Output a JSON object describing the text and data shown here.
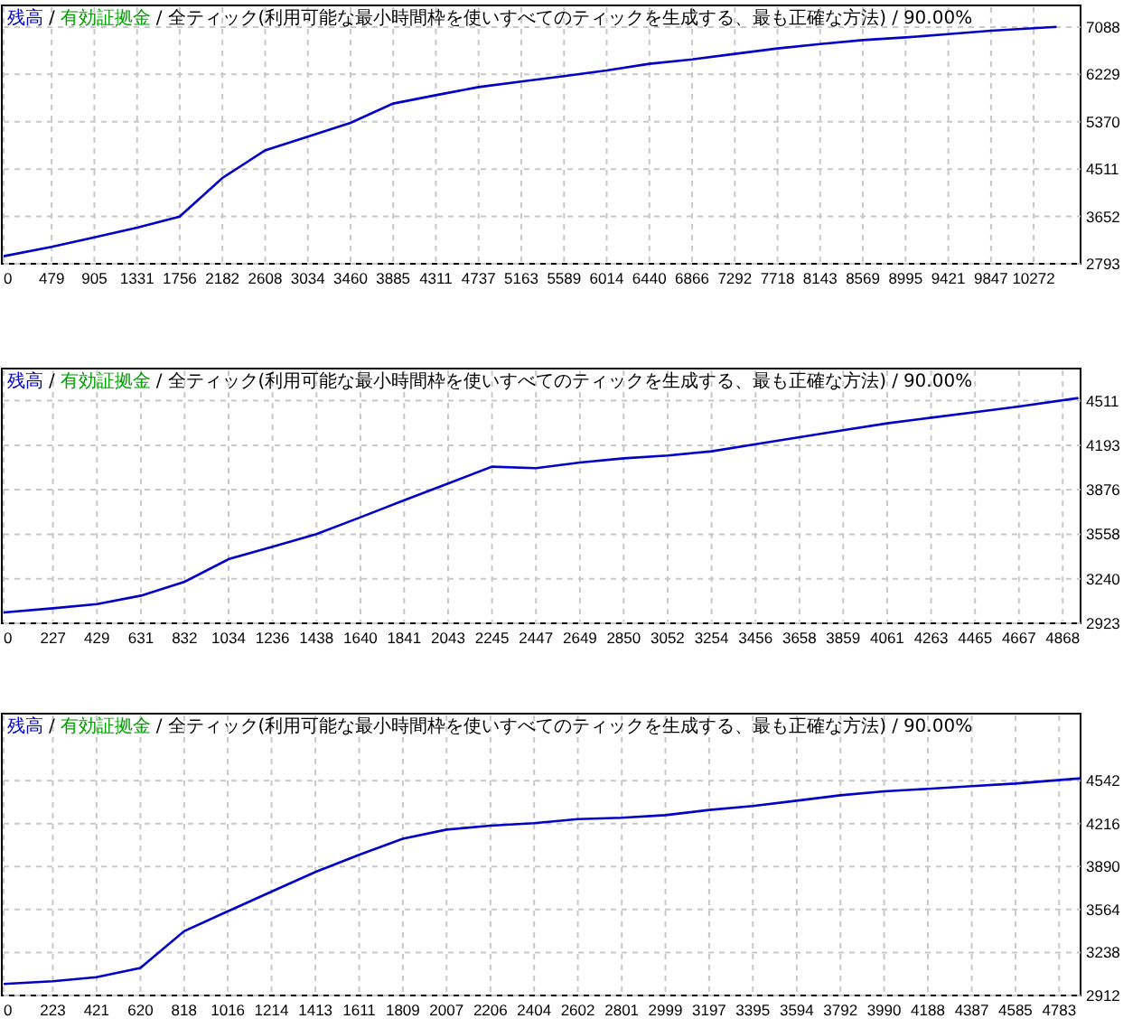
{
  "charts": [
    {
      "header": {
        "separator": "/",
        "equity_label": "有効証拠金",
        "model": "全ティック(利用可能な最小時間枠を使いすべてのティックを生成する、最も正確な方法)",
        "quality": "90.00%"
      },
      "chart_data": {
        "type": "line",
        "x": [
          0,
          479,
          905,
          1331,
          1756,
          2182,
          2608,
          3034,
          3460,
          3885,
          4311,
          4737,
          5163,
          5589,
          6014,
          6440,
          6866,
          7292,
          7718,
          8143,
          8569,
          8995,
          9421,
          9847,
          10500
        ],
        "series": [
          {
            "name": "残高",
            "color": "#0000c8",
            "values": [
              2930,
              3100,
              3270,
              3450,
              3650,
              4350,
              4850,
              5100,
              5350,
              5700,
              5850,
              6000,
              6100,
              6200,
              6300,
              6420,
              6500,
              6600,
              6700,
              6780,
              6850,
              6900,
              6960,
              7020,
              7090
            ]
          }
        ],
        "xlim": [
          0,
          10740
        ],
        "ylim": [
          2793,
          7480
        ],
        "xticks": [
          0,
          479,
          905,
          1331,
          1756,
          2182,
          2608,
          3034,
          3460,
          3885,
          4311,
          4737,
          5163,
          5589,
          6014,
          6440,
          6866,
          7292,
          7718,
          8143,
          8569,
          8995,
          9421,
          9847,
          10272
        ],
        "yticks": [
          2793,
          3652,
          4511,
          5370,
          6229,
          7088
        ],
        "grid": true
      }
    },
    {
      "header": {
        "separator": "/",
        "equity_label": "有効証拠金",
        "model": "全ティック(利用可能な最小時間枠を使いすべてのティックを生成する、最も正確な方法)",
        "quality": "90.00%"
      },
      "chart_data": {
        "type": "line",
        "x": [
          0,
          227,
          429,
          631,
          832,
          1034,
          1236,
          1438,
          1640,
          1841,
          2043,
          2245,
          2447,
          2649,
          2850,
          3052,
          3254,
          3456,
          3658,
          3859,
          4061,
          4263,
          4465,
          4667,
          4940
        ],
        "series": [
          {
            "name": "残高",
            "color": "#0000c8",
            "values": [
              3000,
              3030,
              3060,
              3120,
              3220,
              3380,
              3470,
              3560,
              3680,
              3800,
              3920,
              4040,
              4030,
              4070,
              4100,
              4120,
              4150,
              4200,
              4250,
              4300,
              4350,
              4390,
              4430,
              4470,
              4530
            ]
          }
        ],
        "xlim": [
          0,
          4950
        ],
        "ylim": [
          2923,
          4740
        ],
        "xticks": [
          0,
          227,
          429,
          631,
          832,
          1034,
          1236,
          1438,
          1640,
          1841,
          2043,
          2245,
          2447,
          2649,
          2850,
          3052,
          3254,
          3456,
          3658,
          3859,
          4061,
          4263,
          4465,
          4667,
          4868
        ],
        "yticks": [
          2923,
          3240,
          3558,
          3876,
          4193,
          4511
        ],
        "grid": true
      }
    },
    {
      "header": {
        "separator": "/",
        "equity_label": "有効証拠金",
        "model": "全ティック(利用可能な最小時間枠を使いすべてのティックを生成する、最も正確な方法)",
        "quality": "90.00%"
      },
      "chart_data": {
        "type": "line",
        "x": [
          0,
          223,
          421,
          620,
          818,
          1016,
          1214,
          1413,
          1611,
          1809,
          2007,
          2206,
          2404,
          2602,
          2801,
          2999,
          3197,
          3395,
          3594,
          3792,
          3990,
          4188,
          4387,
          4585,
          4880
        ],
        "series": [
          {
            "name": "残高",
            "color": "#0000c8",
            "values": [
              3000,
              3020,
              3050,
              3120,
              3400,
              3550,
              3700,
              3850,
              3980,
              4100,
              4170,
              4200,
              4220,
              4250,
              4260,
              4280,
              4320,
              4350,
              4390,
              4430,
              4460,
              4480,
              4500,
              4520,
              4560
            ]
          }
        ],
        "xlim": [
          0,
          4880
        ],
        "ylim": [
          2912,
          5050
        ],
        "xticks": [
          0,
          223,
          421,
          620,
          818,
          1016,
          1214,
          1413,
          1611,
          1809,
          2007,
          2206,
          2404,
          2602,
          2801,
          2999,
          3197,
          3395,
          3594,
          3792,
          3990,
          4188,
          4387,
          4585,
          4783
        ],
        "yticks": [
          2912,
          3238,
          3564,
          3890,
          4216,
          4542
        ],
        "grid": true
      }
    }
  ]
}
